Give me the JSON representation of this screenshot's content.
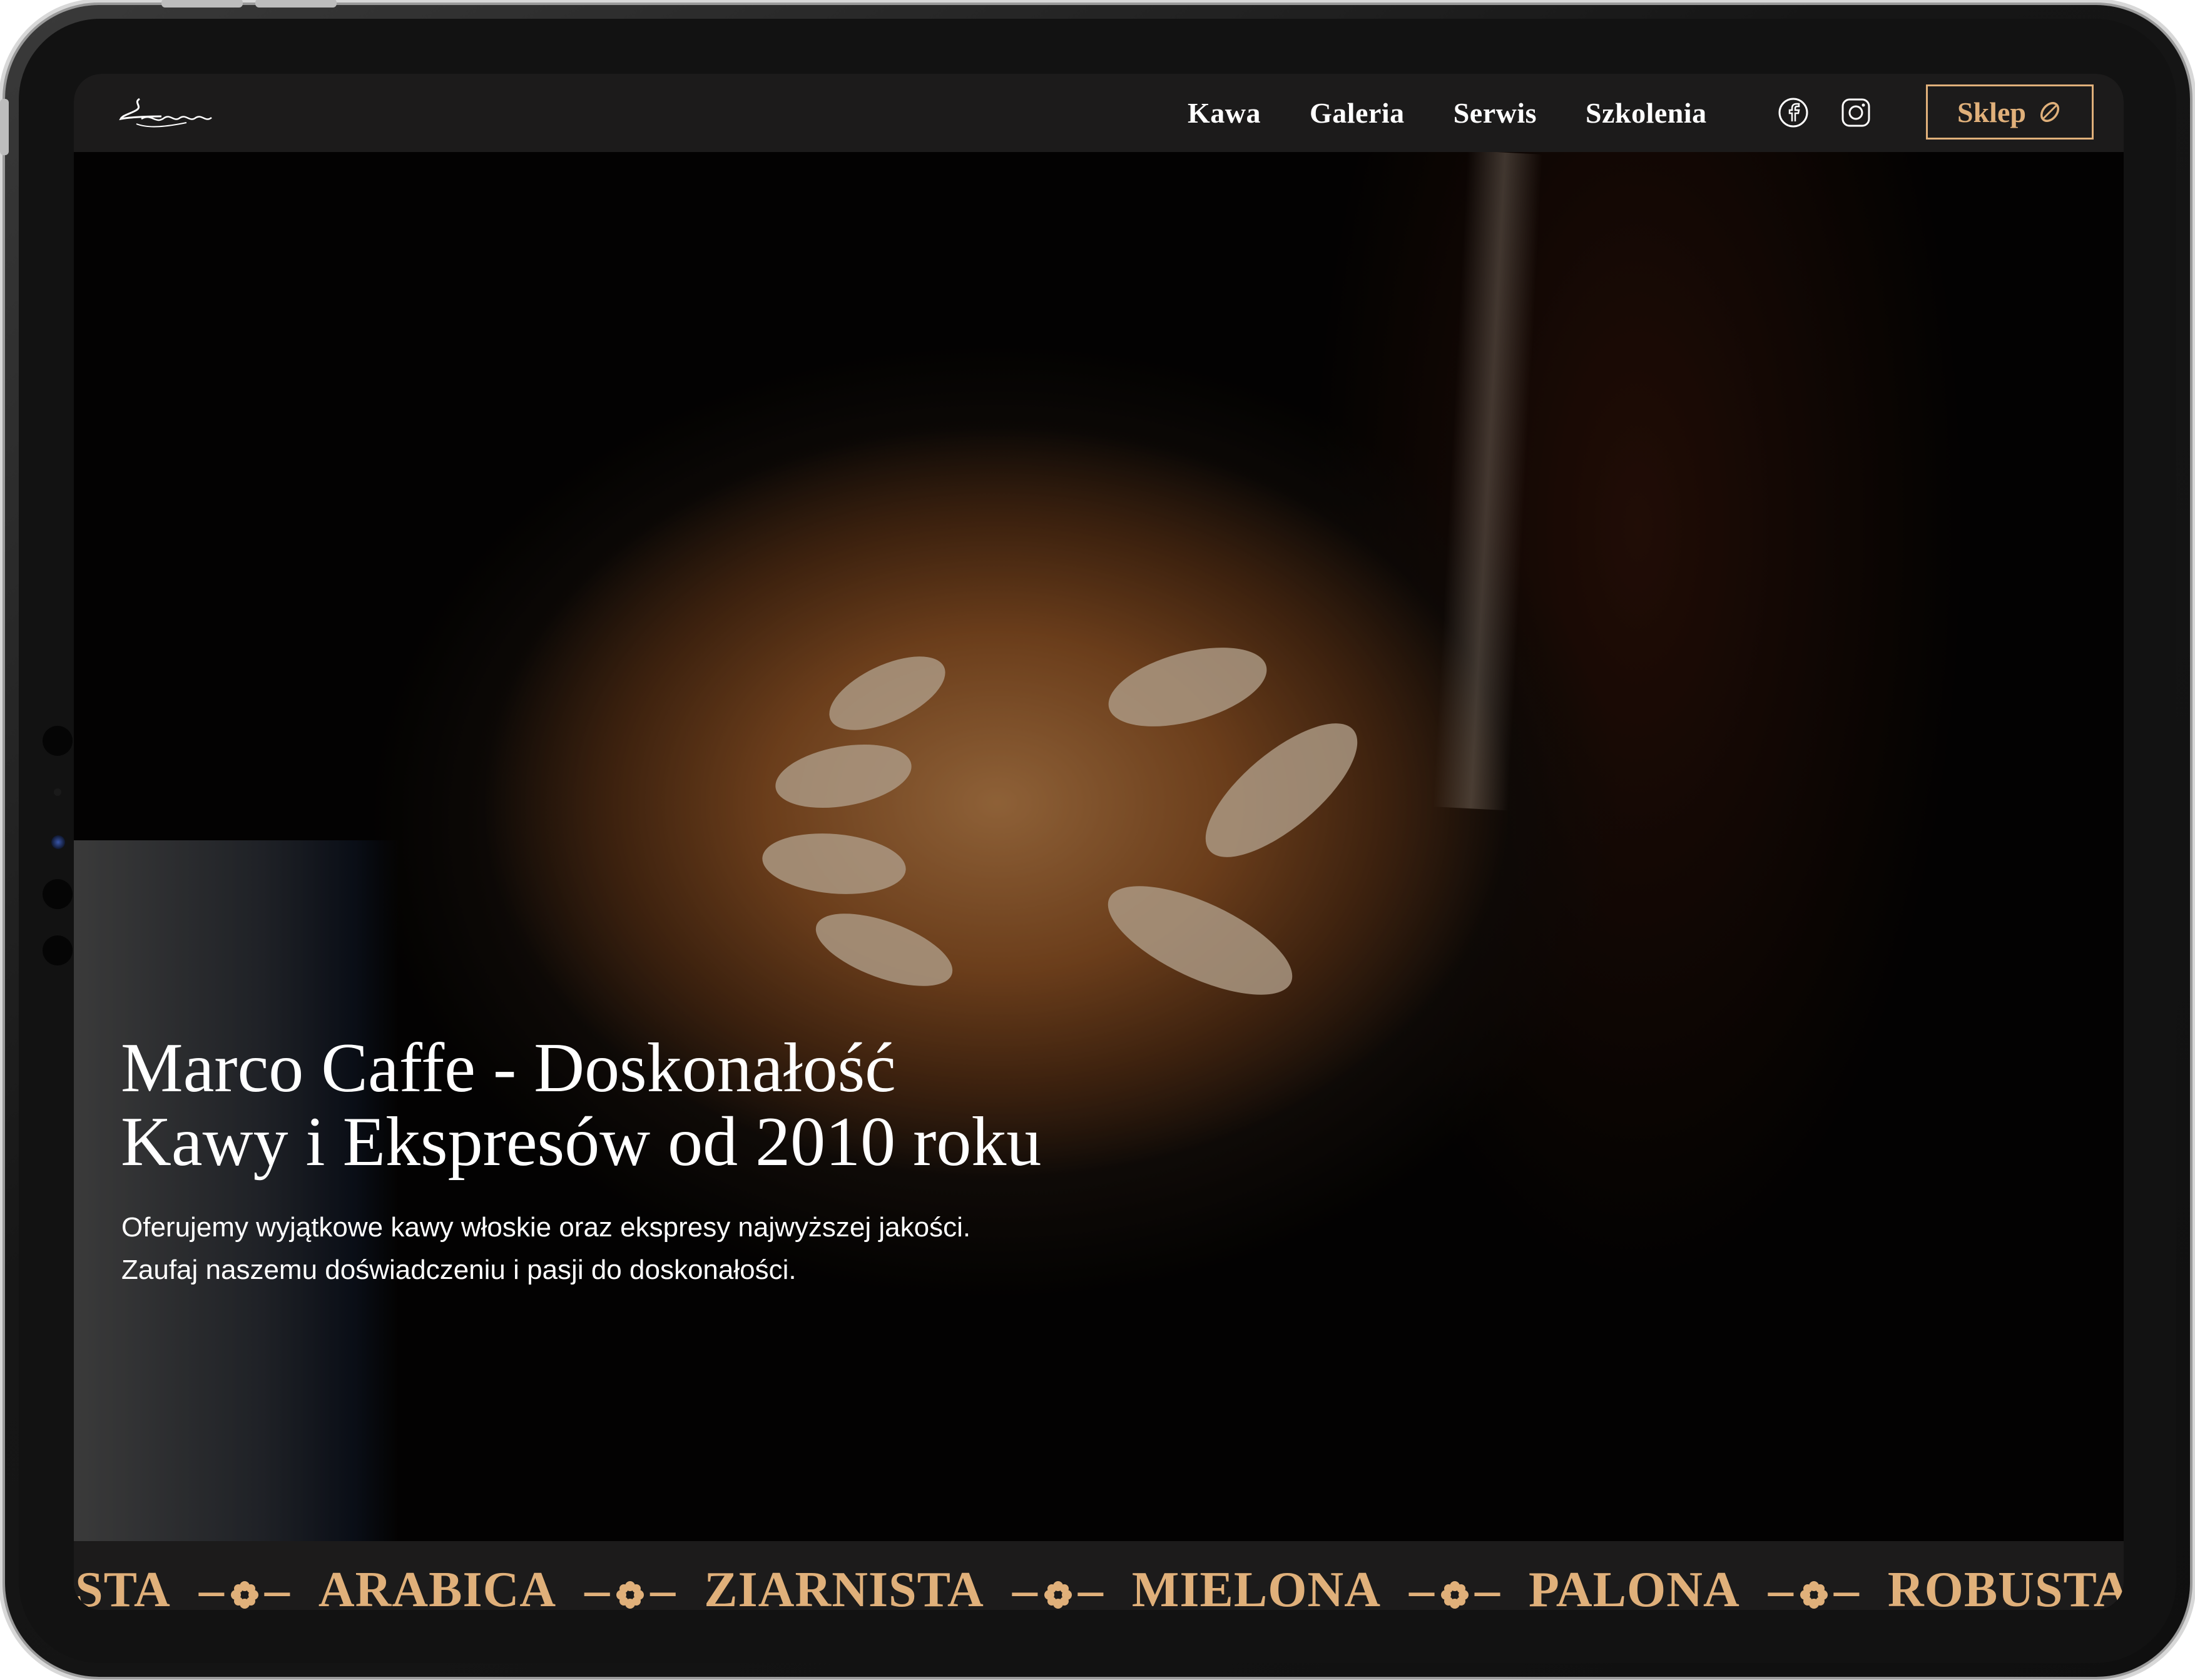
{
  "nav": {
    "links": [
      "Kawa",
      "Galeria",
      "Serwis",
      "Szkolenia"
    ],
    "social": [
      "facebook-icon",
      "instagram-icon"
    ],
    "shop_label": "Sklep",
    "shop_icon": "coffee-bean-icon"
  },
  "hero": {
    "title_line1": "Marco Caffe - Doskonałość",
    "title_line2": "Kawy i Ekspresów od 2010 roku",
    "subtitle_line1": "Oferujemy wyjątkowe kawy włoskie oraz ekspresy najwyższej jakości.",
    "subtitle_line2": "Zaufaj naszemu doświadczeniu i pasji do doskonałości."
  },
  "ticker": {
    "items": [
      "ISTA",
      "ARABICA",
      "ZIARNISTA",
      "MIELONA",
      "PALONA",
      "ROBUSTA"
    ],
    "separator_icon": "flower-icon"
  },
  "colors": {
    "accent": "#e0b07a",
    "nav_background": "#1c1b1b",
    "text": "#ffffff"
  }
}
